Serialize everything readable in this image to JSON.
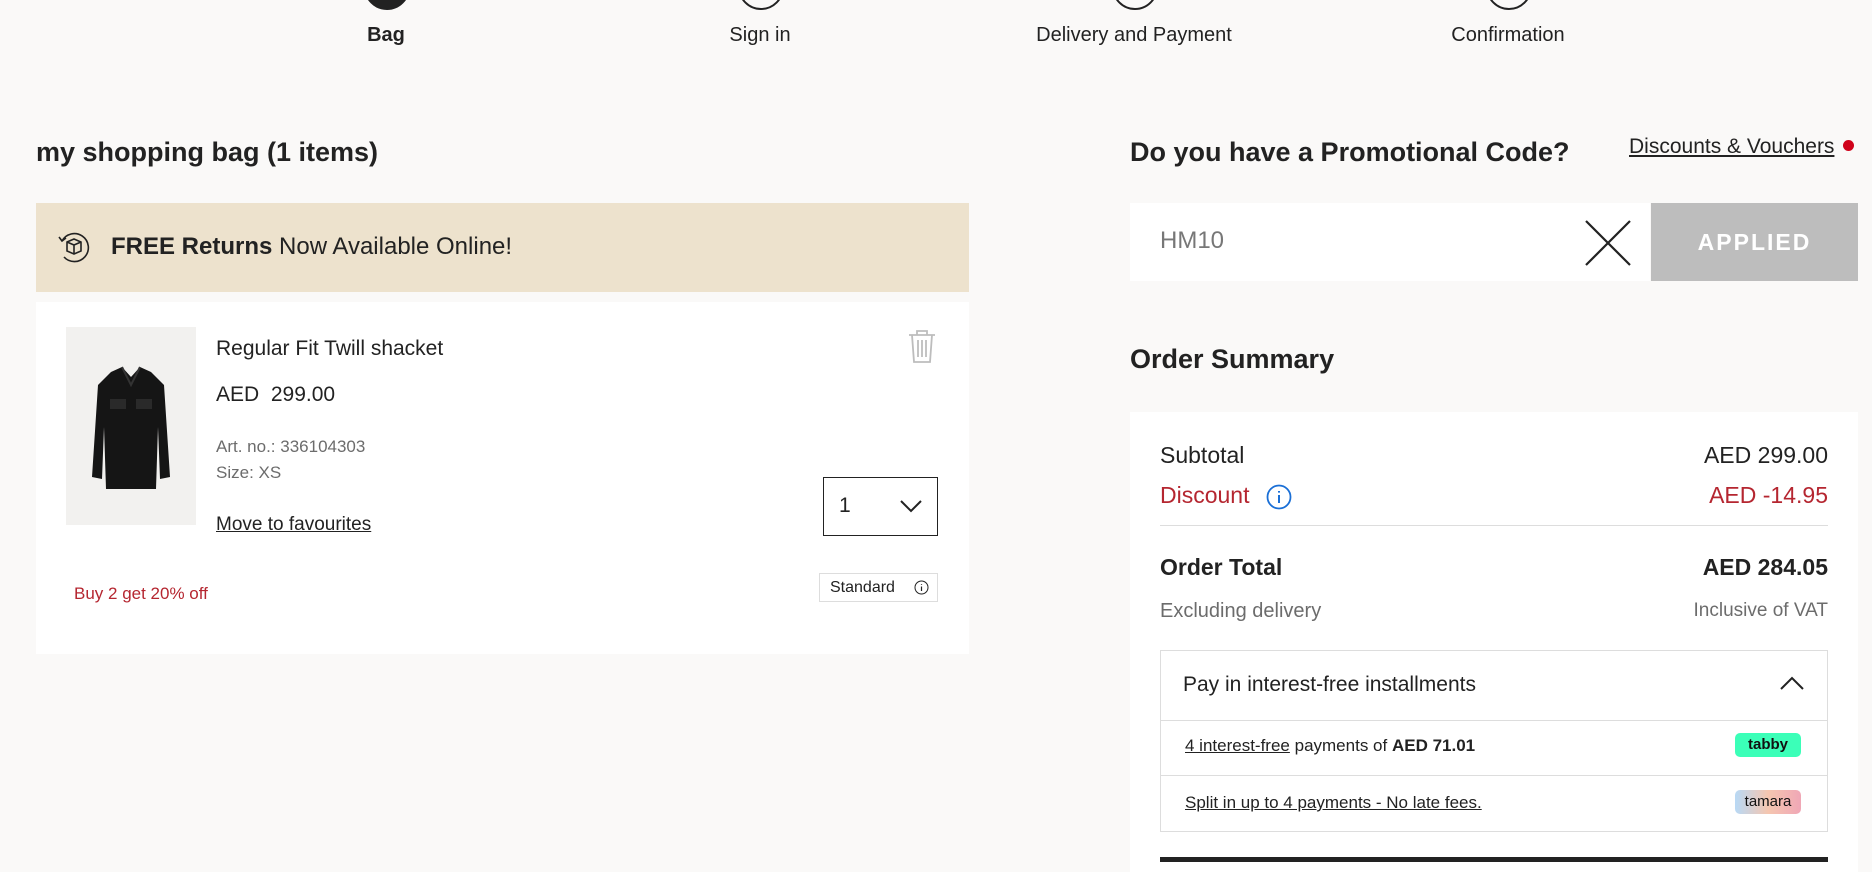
{
  "steps": [
    {
      "label": "Bag",
      "active": true
    },
    {
      "label": "Sign in",
      "active": false
    },
    {
      "label": "Delivery and Payment",
      "active": false
    },
    {
      "label": "Confirmation",
      "active": false
    }
  ],
  "bag": {
    "title": "my shopping bag (1 items)",
    "banner": {
      "bold": "FREE Returns",
      "text": "Now Available Online!",
      "icon": "returns-box-icon"
    },
    "item": {
      "name": "Regular Fit Twill shacket",
      "price": "AED  299.00",
      "art_no": "Art. no.: 336104303",
      "size": "Size: XS",
      "move_to_favourites": "Move to favourites",
      "quantity": "1",
      "promo": "Buy 2 get 20% off",
      "delivery_tag": "Standard"
    }
  },
  "promo": {
    "title": "Do you have a Promotional Code?",
    "discounts_link": "Discounts & Vouchers",
    "code_value": "HM10",
    "applied_label": "APPLIED"
  },
  "summary": {
    "title": "Order Summary",
    "subtotal_label": "Subtotal",
    "subtotal_value": "AED 299.00",
    "discount_label": "Discount",
    "discount_value": "AED -14.95",
    "total_label": "Order Total",
    "total_value": "AED 284.05",
    "excl_delivery": "Excluding delivery",
    "incl_vat": "Inclusive of VAT",
    "installments": {
      "title": "Pay in interest-free installments",
      "tabby_link": "4 interest-free",
      "tabby_text": " payments of ",
      "tabby_amount": "AED 71.01",
      "tabby_badge": "tabby",
      "tamara_link": "Split in up to 4 payments - No late fees.",
      "tamara_badge": "tamara"
    }
  },
  "colors": {
    "accent_red": "#b52630",
    "banner_bg": "#ede2cd",
    "info_blue": "#1a6fd6"
  }
}
